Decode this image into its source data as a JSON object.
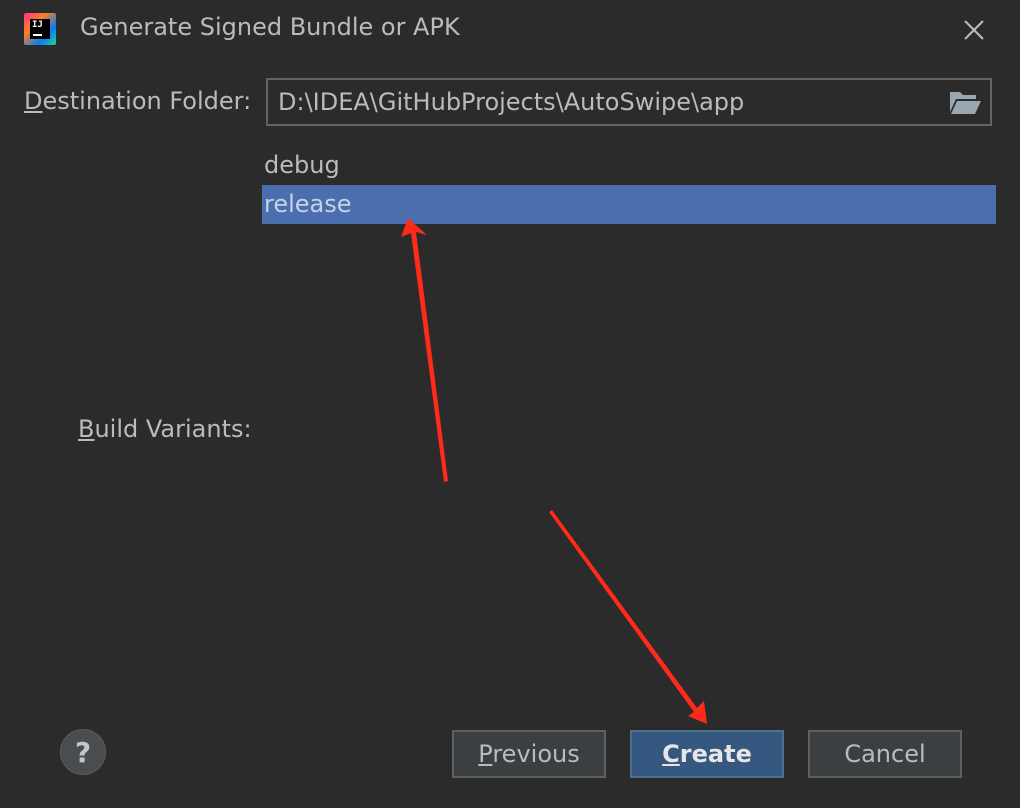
{
  "window": {
    "title": "Generate Signed Bundle or APK",
    "app_icon": "intellij-idea-icon",
    "close_icon": "close-icon"
  },
  "destination": {
    "label_prefix": "D",
    "label_rest": "estination Folder:",
    "value": "D:\\IDEA\\GitHubProjects\\AutoSwipe\\app",
    "browse_icon": "folder-open-icon"
  },
  "build_variants": {
    "label_prefix": "B",
    "label_rest": "uild Variants:",
    "items": [
      {
        "label": "debug",
        "selected": false
      },
      {
        "label": "release",
        "selected": true
      }
    ]
  },
  "footer": {
    "help": "?",
    "previous_prefix": "P",
    "previous_rest": "revious",
    "create_prefix": "C",
    "create_rest": "reate",
    "cancel": "Cancel"
  },
  "colors": {
    "background": "#2b2b2b",
    "selection": "#4b6eaf",
    "primary_button": "#365880",
    "annotation_arrow": "#ff2a1a"
  }
}
